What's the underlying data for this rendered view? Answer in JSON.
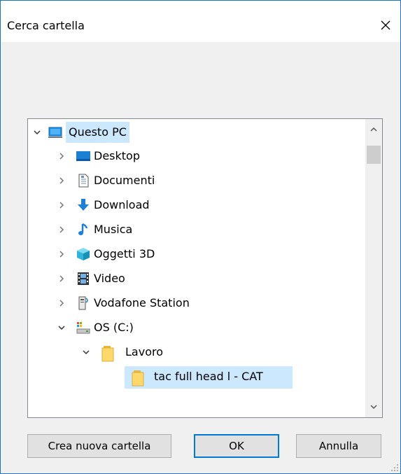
{
  "dialog": {
    "title": "Cerca cartella"
  },
  "tree": {
    "items": [
      {
        "label": "Questo PC",
        "expanded": true,
        "icon": "computer-icon"
      },
      {
        "label": "Desktop",
        "expanded": false,
        "icon": "desktop-folder-icon"
      },
      {
        "label": "Documenti",
        "expanded": false,
        "icon": "documents-folder-icon"
      },
      {
        "label": "Download",
        "expanded": false,
        "icon": "download-arrow-icon"
      },
      {
        "label": "Musica",
        "expanded": false,
        "icon": "music-note-icon"
      },
      {
        "label": "Oggetti 3D",
        "expanded": false,
        "icon": "3d-objects-icon"
      },
      {
        "label": "Video",
        "expanded": false,
        "icon": "video-film-icon"
      },
      {
        "label": "Vodafone Station",
        "expanded": false,
        "icon": "network-device-icon"
      },
      {
        "label": "OS (C:)",
        "expanded": true,
        "icon": "drive-icon"
      },
      {
        "label": "Lavoro",
        "expanded": true,
        "icon": "folder-icon"
      },
      {
        "label": "tac full head l - CAT",
        "selected": true,
        "icon": "folder-icon"
      }
    ]
  },
  "buttons": {
    "new_folder": "Crea nuova cartella",
    "ok": "OK",
    "cancel": "Annulla"
  },
  "colors": {
    "selection": "#cce8ff",
    "accent": "#0078d7",
    "folder": "#ffd86b"
  }
}
